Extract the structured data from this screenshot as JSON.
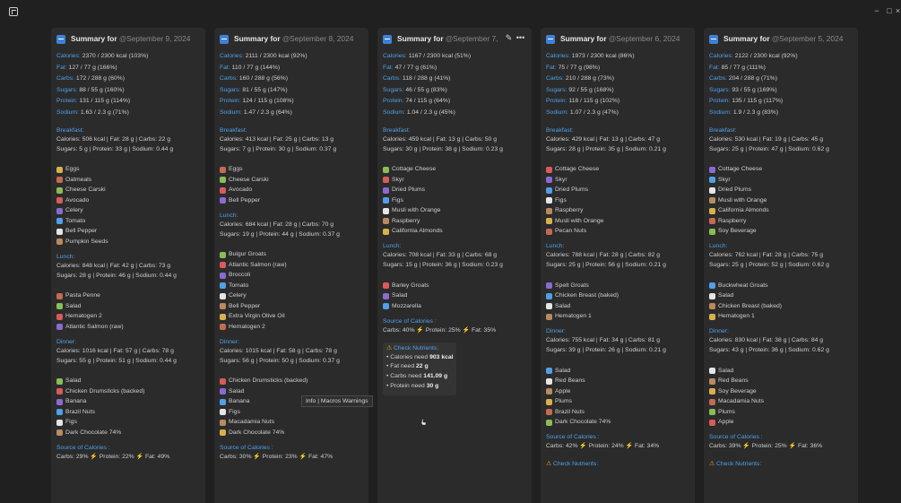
{
  "window": {
    "controls": [
      "−",
      "□",
      "×"
    ]
  },
  "colors": {
    "accent": "#4fa0e8",
    "warning": "#e0b000",
    "bg": "#202020",
    "card": "#2b2b2b"
  },
  "tooltip": "Info | Macros Warnings",
  "cards": [
    {
      "title": "Summary for ",
      "date": "September 9, 2024",
      "nutrients": [
        {
          "label": "Calories:",
          "value": "2370 / 2300 kcal (103%)"
        },
        {
          "label": "Fat:",
          "value": "127 / 77 g (166%)"
        },
        {
          "label": "Carbs:",
          "value": "172 / 288 g (60%)"
        },
        {
          "label": "Sugars:",
          "value": "88 / 55 g (160%)"
        },
        {
          "label": "Protein:",
          "value": "131 / 115 g (114%)"
        },
        {
          "label": "Sodium:",
          "value": "1.63 / 2.3 g (71%)"
        }
      ],
      "meals": [
        {
          "title": "Breakfast:",
          "meta1": "Calories: 506 kcal  |  Fat: 28 g  |  Carbs: 22 g",
          "meta2": "Sugars: 5 g  |  Protein: 33 g  |  Sodium: 0.44 g",
          "items": [
            "Eggs",
            "Oatmeals",
            "Cheese Carski",
            "Avocado",
            "Celery",
            "Tomato",
            "Bell Pepper",
            "Pumpkin Seeds"
          ]
        },
        {
          "title": "Lunch:",
          "meta1": "Calories: 848 kcal  |  Fat: 42 g  |  Carbs: 73 g",
          "meta2": "Sugars: 28 g  |  Protein: 46 g  |  Sodium: 0.44 g",
          "items": [
            "Pasta Penne",
            "Salad",
            "Hematogen 2",
            "Atlantic Salmon (raw)"
          ]
        },
        {
          "title": "Dinner:",
          "meta1": "Calories: 1016 kcal  |  Fat: 57 g  |  Carbs: 78 g",
          "meta2": "Sugars: 55 g  |  Protein: 51 g  |  Sodium: 0.44 g",
          "items": [
            "Salad",
            "Chicken Drumsticks (backed)",
            "Banana",
            "Brazil Nuts",
            "Figs",
            "Dark Chocolate 74%"
          ]
        }
      ],
      "source": {
        "title": "Source of Calories :",
        "carbs": "Carbs: 29%",
        "protein": "Protein: 22%",
        "fat": "Fat: 49%"
      }
    },
    {
      "title": "Summary for ",
      "date": "September 8, 2024",
      "nutrients": [
        {
          "label": "Calories:",
          "value": "2111 / 2300 kcal (92%)"
        },
        {
          "label": "Fat:",
          "value": "110 / 77 g (144%)"
        },
        {
          "label": "Carbs:",
          "value": "160 / 288 g (56%)"
        },
        {
          "label": "Sugars:",
          "value": "81 / 55 g (147%)"
        },
        {
          "label": "Protein:",
          "value": "124 / 115 g (108%)"
        },
        {
          "label": "Sodium:",
          "value": "1.47 / 2.3 g (64%)"
        }
      ],
      "meals": [
        {
          "title": "Breakfast:",
          "meta1": "Calories: 413 kcal  |  Fat: 25 g  |  Carbs: 13 g",
          "meta2": "Sugars: 7 g  |  Protein: 30 g  |  Sodium: 0.37 g",
          "items": [
            "Eggs",
            "Cheese Carski",
            "Avocado",
            "Bell Pepper"
          ]
        },
        {
          "title": "Lunch:",
          "meta1": "Calories: 684 kcal  |  Fat: 28 g  |  Carbs: 70 g",
          "meta2": "Sugars: 19 g  |  Protein: 44 g  |  Sodium: 0.37 g",
          "items": [
            "Bulgur Groats",
            "Atlantic Salmon (raw)",
            "Broccoli",
            "Tomato",
            "Celery",
            "Bell Pepper",
            "Extra Virgin Olive Oil",
            "Hematogen 2"
          ]
        },
        {
          "title": "Dinner:",
          "meta1": "Calories: 1015 kcal  |  Fat: 58 g  |  Carbs: 78 g",
          "meta2": "Sugars: 56 g  |  Protein: 50 g  |  Sodium: 0.37 g",
          "items": [
            "Chicken Drumsticks (backed)",
            "Salad",
            "Banana",
            "Figs",
            "Macadamia Nuts",
            "Dark Chocolate 74%"
          ]
        }
      ],
      "source": {
        "title": "Source of Calories :",
        "carbs": "Carbs: 30%",
        "protein": "Protein: 23%",
        "fat": "Fat: 47%"
      }
    },
    {
      "title": "Summary for ",
      "date": "September 7,",
      "nutrients": [
        {
          "label": "Calories:",
          "value": "1167 / 2300 kcal (51%)"
        },
        {
          "label": "Fat:",
          "value": "47 / 77 g (61%)"
        },
        {
          "label": "Carbs:",
          "value": "118 / 288 g (41%)"
        },
        {
          "label": "Sugars:",
          "value": "46 / 55 g (83%)"
        },
        {
          "label": "Protein:",
          "value": "74 / 115 g (64%)"
        },
        {
          "label": "Sodium:",
          "value": "1.04 / 2.3 g (45%)"
        }
      ],
      "meals": [
        {
          "title": "Breakfast:",
          "meta1": "Calories: 459 kcal  |  Fat: 13 g  |  Carbs: 50 g",
          "meta2": "Sugars: 30 g  |  Protein: 38 g  |  Sodium: 0.23 g",
          "items": [
            "Cottage Cheese",
            "Skyr",
            "Dried Plums",
            "Figs",
            "Musli with Orange",
            "Raspberry",
            "California Almonds"
          ]
        },
        {
          "title": "Lunch:",
          "meta1": "Calories: 708 kcal  |  Fat: 33 g  |  Carbs: 68 g",
          "meta2": "Sugars: 15 g  |  Protein: 36 g  |  Sodium: 0.23 g",
          "items": [
            "Barley Groats",
            "Salad",
            "Mozzarella"
          ]
        }
      ],
      "source": {
        "title": "Source of Calories :",
        "carbs": "Carbs: 40%",
        "protein": "Protein: 25%",
        "fat": "Fat: 35%"
      },
      "warnings": {
        "title": "Check Nutrients:",
        "items": [
          {
            "text": "• Calories need ",
            "value": "903 kcal"
          },
          {
            "text": "• Fat need ",
            "value": "22 g"
          },
          {
            "text": "• Carbs need ",
            "value": "141.09 g"
          },
          {
            "text": "• Protein need ",
            "value": "30 g"
          }
        ]
      }
    },
    {
      "title": "Summary for ",
      "date": "September 6, 2024",
      "nutrients": [
        {
          "label": "Calories:",
          "value": "1973 / 2300 kcal (86%)"
        },
        {
          "label": "Fat:",
          "value": "75 / 77 g (98%)"
        },
        {
          "label": "Carbs:",
          "value": "210 / 288 g (73%)"
        },
        {
          "label": "Sugars:",
          "value": "92 / 55 g (168%)"
        },
        {
          "label": "Protein:",
          "value": "118 / 115 g (102%)"
        },
        {
          "label": "Sodium:",
          "value": "1.07 / 2.3 g (47%)"
        }
      ],
      "meals": [
        {
          "title": "Breakfast:",
          "meta1": "Calories: 429 kcal  |  Fat: 13 g  |  Carbs: 47 g",
          "meta2": "Sugars: 28 g  |  Protein: 35 g  |  Sodium: 0.21 g",
          "items": [
            "Cottage Cheese",
            "Skyr",
            "Dried Plums",
            "Figs",
            "Raspberry",
            "Musli with Orange",
            "Pecan Nuts"
          ]
        },
        {
          "title": "Lunch:",
          "meta1": "Calories: 788 kcal  |  Fat: 28 g  |  Carbs: 82 g",
          "meta2": "Sugars: 25 g  |  Protein: 56 g  |  Sodium: 0.21 g",
          "items": [
            "Spelt Groats",
            "Chicken Breast (baked)",
            "Salad",
            "Hematogen 1"
          ]
        },
        {
          "title": "Dinner:",
          "meta1": "Calories: 755 kcal  |  Fat: 34 g  |  Carbs: 81 g",
          "meta2": "Sugars: 39 g  |  Protein: 26 g  |  Sodium: 0.21 g",
          "items": [
            "Salad",
            "Red Beans",
            "Apple",
            "Plums",
            "Brazil Nuts",
            "Dark Chocolate 74%"
          ]
        }
      ],
      "source": {
        "title": "Source of Calories :",
        "carbs": "Carbs: 42%",
        "protein": "Protein: 24%",
        "fat": "Fat: 34%"
      },
      "warnings": {
        "title": "Check Nutrients:",
        "items": []
      }
    },
    {
      "title": "Summary for ",
      "date": "September 5, 2024",
      "nutrients": [
        {
          "label": "Calories:",
          "value": "2122 / 2300 kcal (92%)"
        },
        {
          "label": "Fat:",
          "value": "85 / 77 g (111%)"
        },
        {
          "label": "Carbs:",
          "value": "204 / 288 g (71%)"
        },
        {
          "label": "Sugars:",
          "value": "93 / 55 g (169%)"
        },
        {
          "label": "Protein:",
          "value": "135 / 115 g (117%)"
        },
        {
          "label": "Sodium:",
          "value": "1.9 / 2.3 g (83%)"
        }
      ],
      "meals": [
        {
          "title": "Breakfast:",
          "meta1": "Calories: 530 kcal  |  Fat: 19 g  |  Carbs: 45 g",
          "meta2": "Sugars: 25 g  |  Protein: 47 g  |  Sodium: 0.62 g",
          "items": [
            "Cottage Cheese",
            "Skyr",
            "Dried Plums",
            "Musli with Orange",
            "California Almonds",
            "Raspberry",
            "Soy Beverage"
          ]
        },
        {
          "title": "Lunch:",
          "meta1": "Calories: 762 kcal  |  Fat: 28 g  |  Carbs: 75 g",
          "meta2": "Sugars: 25 g  |  Protein: 52 g  |  Sodium: 0.62 g",
          "items": [
            "Buckwheat Groats",
            "Salad",
            "Chicken Breast (baked)",
            "Hematogen 1"
          ]
        },
        {
          "title": "Dinner:",
          "meta1": "Calories: 830 kcal  |  Fat: 38 g  |  Carbs: 84 g",
          "meta2": "Sugars: 43 g  |  Protein: 36 g  |  Sodium: 0.62 g",
          "items": [
            "Salad",
            "Red Beans",
            "Soy Beverage",
            "Macadamia Nuts",
            "Plums",
            "Apple"
          ]
        }
      ],
      "source": {
        "title": "Source of Calories :",
        "carbs": "Carbs: 39%",
        "protein": "Protein: 25%",
        "fat": "Fat: 36%"
      },
      "warnings": {
        "title": "Check Nutrients:",
        "items": []
      }
    }
  ]
}
